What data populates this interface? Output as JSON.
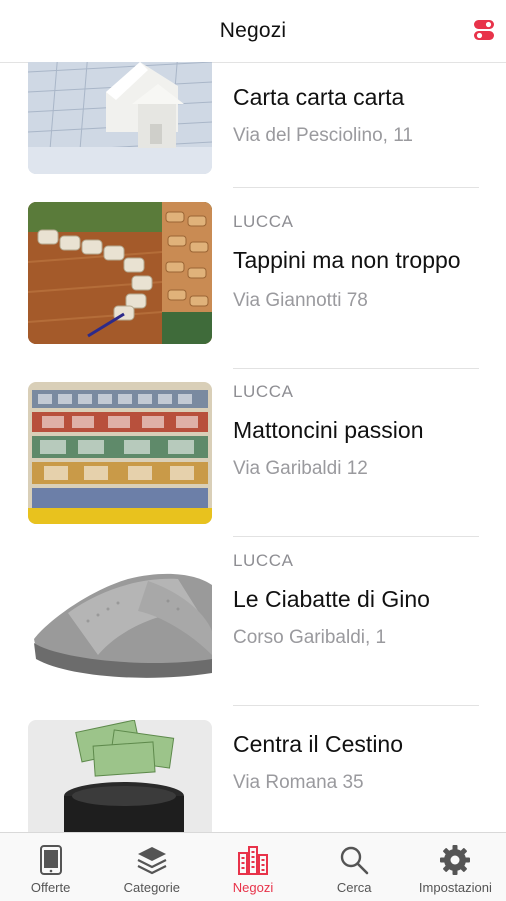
{
  "header": {
    "title": "Negozi",
    "filter_icon": "toggle-switches-icon"
  },
  "stores": [
    {
      "city": "",
      "name": "Carta carta carta",
      "address": "Via del Pesciolino, 11"
    },
    {
      "city": "LUCCA",
      "name": "Tappini ma non troppo",
      "address": "Via Giannotti 78"
    },
    {
      "city": "LUCCA",
      "name": "Mattoncini passion",
      "address": "Via Garibaldi 12"
    },
    {
      "city": "LUCCA",
      "name": "Le Ciabatte di Gino",
      "address": "Corso Garibaldi, 1"
    },
    {
      "city": "",
      "name": "Centra il Cestino",
      "address": "Via Romana 35"
    }
  ],
  "tabs": [
    {
      "label": "Offerte",
      "icon": "tablet-icon"
    },
    {
      "label": "Categorie",
      "icon": "layers-icon"
    },
    {
      "label": "Negozi",
      "icon": "buildings-icon",
      "active": true
    },
    {
      "label": "Cerca",
      "icon": "search-icon"
    },
    {
      "label": "Impostazioni",
      "icon": "gear-icon"
    }
  ],
  "colors": {
    "accent": "#e8334a",
    "text": "#111111",
    "secondary": "#8e8e93"
  }
}
